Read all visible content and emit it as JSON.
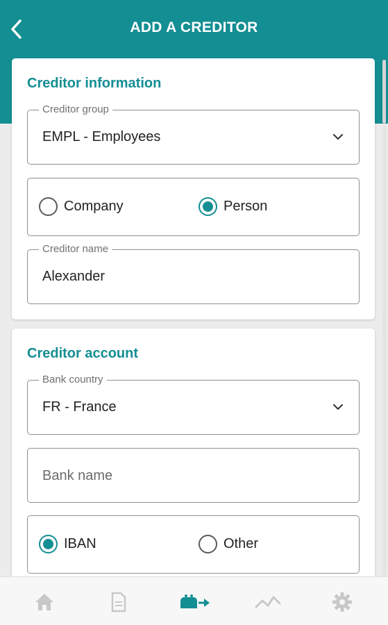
{
  "header": {
    "title": "ADD A CREDITOR",
    "back_icon": "chevron-left-icon"
  },
  "creditor_information": {
    "title": "Creditor information",
    "group": {
      "label": "Creditor group",
      "value": "EMPL - Employees"
    },
    "type": {
      "options": [
        "Company",
        "Person"
      ],
      "selected": "Person"
    },
    "name": {
      "label": "Creditor name",
      "value": "Alexander"
    }
  },
  "creditor_account": {
    "title": "Creditor account",
    "country": {
      "label": "Bank country",
      "value": "FR - France"
    },
    "bank_name": {
      "placeholder": "Bank name",
      "value": ""
    },
    "account_type": {
      "options": [
        "IBAN",
        "Other"
      ],
      "selected": "IBAN"
    }
  },
  "bottom_nav": {
    "items": [
      "home-icon",
      "document-icon",
      "transfer-icon",
      "chart-icon",
      "gear-icon"
    ],
    "active": "transfer-icon"
  },
  "colors": {
    "accent": "#138e93",
    "inactive_icon": "#c8c8c8"
  }
}
